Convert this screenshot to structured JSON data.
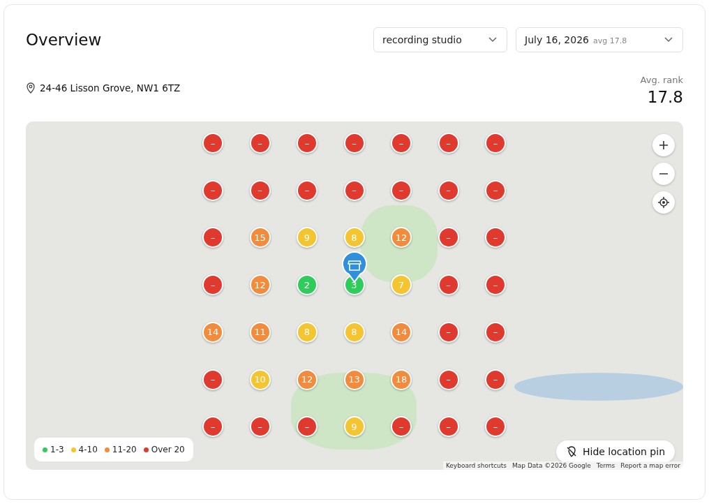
{
  "header": {
    "title": "Overview",
    "keyword_select": {
      "value": "recording studio"
    },
    "date_select": {
      "value": "July 16, 2026",
      "note": "avg 17.8"
    }
  },
  "location": {
    "address": "24-46 Lisson Grove, NW1 6TZ"
  },
  "summary": {
    "label": "Avg. rank",
    "value": "17.8"
  },
  "map": {
    "grid": [
      [
        {
          "rank": "–",
          "color": "#e03a2f"
        },
        {
          "rank": "–",
          "color": "#e03a2f"
        },
        {
          "rank": "–",
          "color": "#e03a2f"
        },
        {
          "rank": "–",
          "color": "#e03a2f"
        },
        {
          "rank": "–",
          "color": "#e03a2f"
        },
        {
          "rank": "–",
          "color": "#e03a2f"
        },
        {
          "rank": "–",
          "color": "#e03a2f"
        }
      ],
      [
        {
          "rank": "–",
          "color": "#e03a2f"
        },
        {
          "rank": "–",
          "color": "#e03a2f"
        },
        {
          "rank": "–",
          "color": "#e03a2f"
        },
        {
          "rank": "–",
          "color": "#e03a2f"
        },
        {
          "rank": "–",
          "color": "#e03a2f"
        },
        {
          "rank": "–",
          "color": "#e03a2f"
        },
        {
          "rank": "–",
          "color": "#e03a2f"
        }
      ],
      [
        {
          "rank": "–",
          "color": "#e03a2f"
        },
        {
          "rank": "15",
          "color": "#f28c3c"
        },
        {
          "rank": "9",
          "color": "#f5c431"
        },
        {
          "rank": "8",
          "color": "#f5c431"
        },
        {
          "rank": "12",
          "color": "#f28c3c"
        },
        {
          "rank": "–",
          "color": "#e03a2f"
        },
        {
          "rank": "–",
          "color": "#e03a2f"
        }
      ],
      [
        {
          "rank": "–",
          "color": "#e03a2f"
        },
        {
          "rank": "12",
          "color": "#f28c3c"
        },
        {
          "rank": "2",
          "color": "#2ecc5a"
        },
        {
          "rank": "3",
          "color": "#2ecc5a"
        },
        {
          "rank": "7",
          "color": "#f5c431"
        },
        {
          "rank": "–",
          "color": "#e03a2f"
        },
        {
          "rank": "–",
          "color": "#e03a2f"
        }
      ],
      [
        {
          "rank": "14",
          "color": "#f28c3c"
        },
        {
          "rank": "11",
          "color": "#f28c3c"
        },
        {
          "rank": "8",
          "color": "#f5c431"
        },
        {
          "rank": "8",
          "color": "#f5c431"
        },
        {
          "rank": "14",
          "color": "#f28c3c"
        },
        {
          "rank": "–",
          "color": "#e03a2f"
        },
        {
          "rank": "–",
          "color": "#e03a2f"
        }
      ],
      [
        {
          "rank": "–",
          "color": "#e03a2f"
        },
        {
          "rank": "10",
          "color": "#f5c431"
        },
        {
          "rank": "12",
          "color": "#f28c3c"
        },
        {
          "rank": "13",
          "color": "#f28c3c"
        },
        {
          "rank": "18",
          "color": "#f28c3c"
        },
        {
          "rank": "–",
          "color": "#e03a2f"
        },
        {
          "rank": "–",
          "color": "#e03a2f"
        }
      ],
      [
        {
          "rank": "–",
          "color": "#e03a2f"
        },
        {
          "rank": "–",
          "color": "#e03a2f"
        },
        {
          "rank": "–",
          "color": "#e03a2f"
        },
        {
          "rank": "9",
          "color": "#f5c431"
        },
        {
          "rank": "–",
          "color": "#e03a2f"
        },
        {
          "rank": "–",
          "color": "#e03a2f"
        },
        {
          "rank": "–",
          "color": "#e03a2f"
        }
      ]
    ],
    "legend": [
      {
        "label": "1-3",
        "color": "#2ecc5a"
      },
      {
        "label": "4-10",
        "color": "#f5c431"
      },
      {
        "label": "11-20",
        "color": "#f28c3c"
      },
      {
        "label": "Over 20",
        "color": "#e03a2f"
      }
    ],
    "hide_pin_button": "Hide location pin",
    "attribution": [
      "Keyboard shortcuts",
      "Map Data ©2026 Google",
      "Terms",
      "Report a map error"
    ]
  }
}
